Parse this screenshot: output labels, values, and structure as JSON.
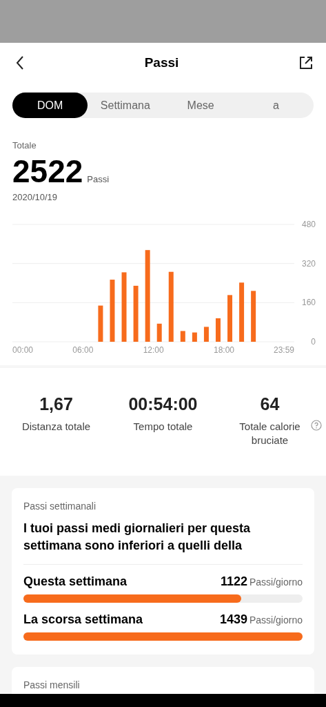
{
  "header": {
    "title": "Passi"
  },
  "tabs": [
    {
      "label": "DOM",
      "selected": true
    },
    {
      "label": "Settimana",
      "selected": false
    },
    {
      "label": "Mese",
      "selected": false
    },
    {
      "label": "a",
      "selected": false
    }
  ],
  "summary": {
    "label": "Totale",
    "value": "2522",
    "unit": "Passi",
    "date": "2020/10/19"
  },
  "chart_data": {
    "type": "bar",
    "x": [
      7.5,
      8.5,
      9.5,
      10.5,
      11.5,
      12.5,
      13.5,
      14.5,
      15.5,
      16.5,
      17.5,
      18.5,
      19.5,
      20.5
    ],
    "series": [
      {
        "color": "#f76b1c",
        "values": [
          148,
          254,
          284,
          229,
          375,
          74,
          286,
          44,
          38,
          61,
          96,
          191,
          242,
          208
        ]
      }
    ],
    "xlim": [
      0,
      23.98
    ],
    "ylim": [
      0,
      480
    ],
    "yticks": [
      0,
      160,
      320,
      480
    ],
    "xticks": [
      {
        "value": 0,
        "label": "00:00"
      },
      {
        "value": 6,
        "label": "06:00"
      },
      {
        "value": 12,
        "label": "12:00"
      },
      {
        "value": 18,
        "label": "18:00"
      },
      {
        "value": 23.98,
        "label": "23:59"
      }
    ]
  },
  "stats": [
    {
      "value": "1,67",
      "label": "Distanza totale",
      "help": false
    },
    {
      "value": "00:54:00",
      "label": "Tempo totale",
      "help": false
    },
    {
      "value": "64",
      "label": "Totale calorie bruciate",
      "help": true
    }
  ],
  "weekly_card": {
    "title": "Passi settimanali",
    "message": "I tuoi passi medi giornalieri per questa settimana sono inferiori a quelli della",
    "rows": [
      {
        "label": "Questa settimana",
        "value": "1122",
        "unit": "Passi/giorno",
        "level": 0.78
      },
      {
        "label": "La scorsa settimana",
        "value": "1439",
        "unit": "Passi/giorno",
        "level": 1
      }
    ]
  },
  "monthly_card": {
    "title": "Passi mensili"
  }
}
